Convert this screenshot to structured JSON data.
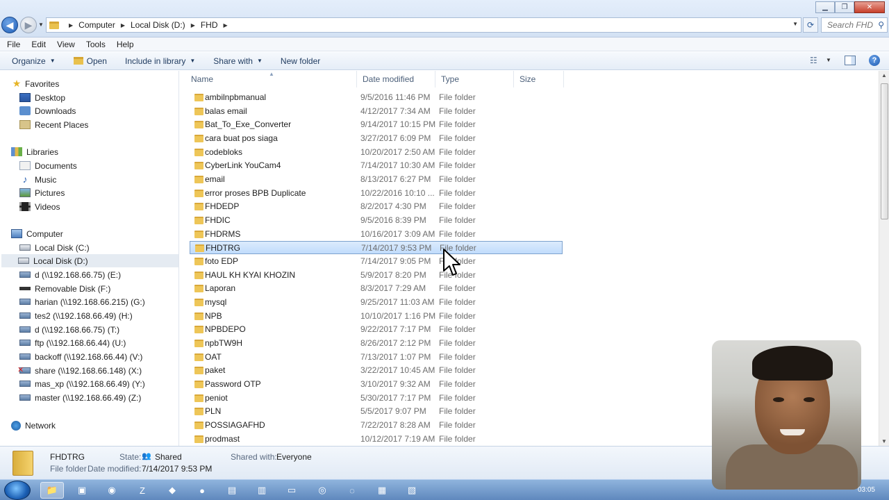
{
  "window": {
    "minimize_icon": "minimize-icon",
    "maximize_icon": "restore-icon",
    "close_icon": "close-icon"
  },
  "address": {
    "crumbs": [
      "Computer",
      "Local Disk (D:)",
      "FHD"
    ],
    "search_placeholder": "Search FHD"
  },
  "menu": [
    "File",
    "Edit",
    "View",
    "Tools",
    "Help"
  ],
  "toolbar": {
    "organize": "Organize",
    "open": "Open",
    "include_in_library": "Include in library",
    "share_with": "Share with",
    "new_folder": "New folder"
  },
  "nav": {
    "favorites": "Favorites",
    "favorites_items": [
      "Desktop",
      "Downloads",
      "Recent Places"
    ],
    "libraries": "Libraries",
    "libraries_items": [
      "Documents",
      "Music",
      "Pictures",
      "Videos"
    ],
    "computer": "Computer",
    "computer_items": [
      "Local Disk (C:)",
      "Local Disk (D:)",
      "d (\\\\192.168.66.75) (E:)",
      "Removable Disk (F:)",
      "harian (\\\\192.168.66.215) (G:)",
      "tes2 (\\\\192.168.66.49) (H:)",
      "d (\\\\192.168.66.75) (T:)",
      "ftp (\\\\192.168.66.44) (U:)",
      "backoff (\\\\192.168.66.44) (V:)",
      "share (\\\\192.168.66.148) (X:)",
      "mas_xp (\\\\192.168.66.49) (Y:)",
      "master (\\\\192.168.66.49) (Z:)"
    ],
    "network": "Network",
    "selected": "Local Disk (D:)"
  },
  "columns": [
    "Name",
    "Date modified",
    "Type",
    "Size"
  ],
  "files": [
    {
      "name": "ambilnpbmanual",
      "date": "9/5/2016 11:46 PM",
      "type": "File folder"
    },
    {
      "name": "balas email",
      "date": "4/12/2017 7:34 AM",
      "type": "File folder"
    },
    {
      "name": "Bat_To_Exe_Converter",
      "date": "9/14/2017 10:15 PM",
      "type": "File folder"
    },
    {
      "name": "cara buat pos siaga",
      "date": "3/27/2017 6:09 PM",
      "type": "File folder"
    },
    {
      "name": "codebloks",
      "date": "10/20/2017 2:50 AM",
      "type": "File folder"
    },
    {
      "name": "CyberLink YouCam4",
      "date": "7/14/2017 10:30 AM",
      "type": "File folder"
    },
    {
      "name": "email",
      "date": "8/13/2017 6:27 PM",
      "type": "File folder"
    },
    {
      "name": "error proses BPB Duplicate",
      "date": "10/22/2016 10:10 ...",
      "type": "File folder"
    },
    {
      "name": "FHDEDP",
      "date": "8/2/2017 4:30 PM",
      "type": "File folder"
    },
    {
      "name": "FHDIC",
      "date": "9/5/2016 8:39 PM",
      "type": "File folder"
    },
    {
      "name": "FHDRMS",
      "date": "10/16/2017 3:09 AM",
      "type": "File folder"
    },
    {
      "name": "FHDTRG",
      "date": "7/14/2017 9:53 PM",
      "type": "File folder",
      "selected": true
    },
    {
      "name": "foto EDP",
      "date": "7/14/2017 9:05 PM",
      "type": "File folder"
    },
    {
      "name": "HAUL KH KYAI KHOZIN",
      "date": "5/9/2017 8:20 PM",
      "type": "File folder"
    },
    {
      "name": "Laporan",
      "date": "8/3/2017 7:29 AM",
      "type": "File folder"
    },
    {
      "name": "mysql",
      "date": "9/25/2017 11:03 AM",
      "type": "File folder"
    },
    {
      "name": "NPB",
      "date": "10/10/2017 1:16 PM",
      "type": "File folder"
    },
    {
      "name": "NPBDEPO",
      "date": "9/22/2017 7:17 PM",
      "type": "File folder"
    },
    {
      "name": "npbTW9H",
      "date": "8/26/2017 2:12 PM",
      "type": "File folder"
    },
    {
      "name": "OAT",
      "date": "7/13/2017 1:07 PM",
      "type": "File folder"
    },
    {
      "name": "paket",
      "date": "3/22/2017 10:45 AM",
      "type": "File folder"
    },
    {
      "name": "Password OTP",
      "date": "3/10/2017 9:32 AM",
      "type": "File folder"
    },
    {
      "name": "peniot",
      "date": "5/30/2017 7:17 PM",
      "type": "File folder"
    },
    {
      "name": "PLN",
      "date": "5/5/2017 9:07 PM",
      "type": "File folder"
    },
    {
      "name": "POSSIAGAFHD",
      "date": "7/22/2017 8:28 AM",
      "type": "File folder"
    },
    {
      "name": "prodmast",
      "date": "10/12/2017 7:19 AM",
      "type": "File folder"
    }
  ],
  "details": {
    "name": "FHDTRG",
    "kind": "File folder",
    "date_label": "Date modified:",
    "date_value": "7/14/2017 9:53 PM",
    "state_label": "State:",
    "state_value": "Shared",
    "shared_label": "Shared with:",
    "shared_value": "Everyone"
  },
  "taskbar": {
    "clock": "03:05"
  }
}
